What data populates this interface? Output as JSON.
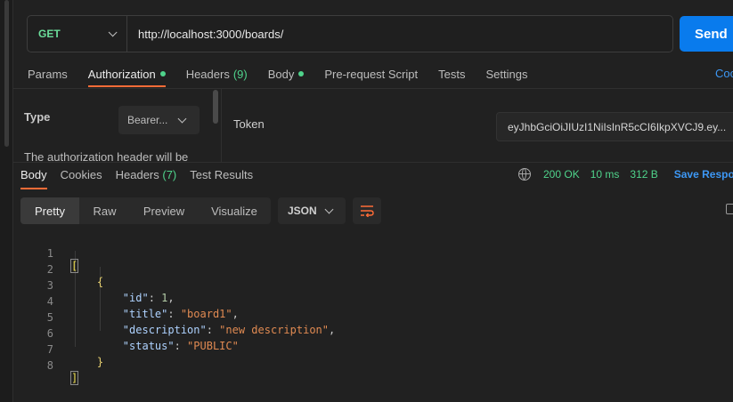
{
  "request": {
    "method": "GET",
    "url": "http://localhost:3000/boards/",
    "send_label": "Send"
  },
  "request_tabs": [
    {
      "label": "Params"
    },
    {
      "label": "Authorization",
      "dot": true
    },
    {
      "label": "Headers",
      "count": "(9)"
    },
    {
      "label": "Body",
      "dot": true
    },
    {
      "label": "Pre-request Script"
    },
    {
      "label": "Tests"
    },
    {
      "label": "Settings"
    }
  ],
  "code_link": "Coo",
  "auth": {
    "type_label": "Type",
    "type_value": "Bearer...",
    "description": "The authorization header will be",
    "token_label": "Token",
    "token_value": "eyJhbGciOiJIUzI1NiIsInR5cCI6IkpXVCJ9.ey..."
  },
  "response_tabs": [
    {
      "label": "Body"
    },
    {
      "label": "Cookies"
    },
    {
      "label": "Headers",
      "count": "(7)"
    },
    {
      "label": "Test Results"
    }
  ],
  "response_meta": {
    "status": "200 OK",
    "time": "10 ms",
    "size": "312 B",
    "save_label": "Save Respor"
  },
  "format_tabs": [
    "Pretty",
    "Raw",
    "Preview",
    "Visualize"
  ],
  "format_select": "JSON",
  "code_lines": [
    {
      "n": "1"
    },
    {
      "n": "2"
    },
    {
      "n": "3"
    },
    {
      "n": "4"
    },
    {
      "n": "5"
    },
    {
      "n": "6"
    },
    {
      "n": "7"
    },
    {
      "n": "8"
    }
  ],
  "json_body": {
    "open_bracket": "[",
    "open_brace": "{",
    "fields": [
      {
        "key": "\"id\"",
        "value": "1",
        "kind": "num"
      },
      {
        "key": "\"title\"",
        "value": "\"board1\"",
        "kind": "str"
      },
      {
        "key": "\"description\"",
        "value": "\"new description\"",
        "kind": "str"
      },
      {
        "key": "\"status\"",
        "value": "\"PUBLIC\"",
        "kind": "str"
      }
    ],
    "close_brace": "}",
    "close_bracket": "]"
  },
  "colors": {
    "accent": "#ff6c37",
    "send": "#097bed",
    "success": "#4fd38b",
    "link": "#3d98f5"
  }
}
